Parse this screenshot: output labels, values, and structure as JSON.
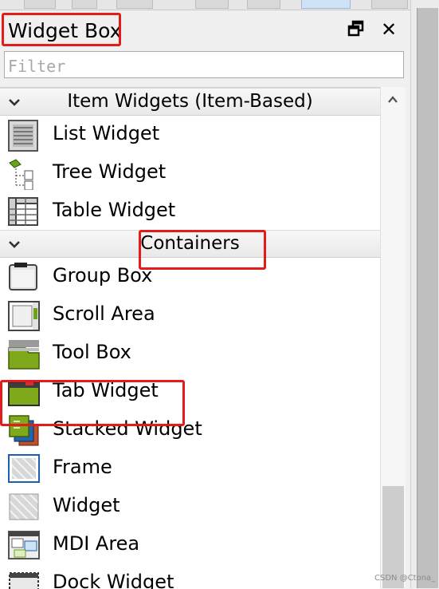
{
  "window": {
    "title": "Widget Box"
  },
  "filter": {
    "placeholder": "Filter"
  },
  "categories": [
    {
      "label": "Item Widgets (Item-Based)",
      "items": [
        {
          "label": "List Widget",
          "icon": "list-widget-icon"
        },
        {
          "label": "Tree Widget",
          "icon": "tree-widget-icon"
        },
        {
          "label": "Table Widget",
          "icon": "table-widget-icon"
        }
      ]
    },
    {
      "label": "Containers",
      "items": [
        {
          "label": "Group Box",
          "icon": "group-box-icon"
        },
        {
          "label": "Scroll Area",
          "icon": "scroll-area-icon"
        },
        {
          "label": "Tool Box",
          "icon": "tool-box-icon"
        },
        {
          "label": "Tab Widget",
          "icon": "tab-widget-icon"
        },
        {
          "label": "Stacked Widget",
          "icon": "stacked-widget-icon"
        },
        {
          "label": "Frame",
          "icon": "frame-icon"
        },
        {
          "label": "Widget",
          "icon": "widget-icon"
        },
        {
          "label": "MDI Area",
          "icon": "mdi-area-icon"
        },
        {
          "label": "Dock Widget",
          "icon": "dock-widget-icon"
        }
      ]
    }
  ],
  "watermark": "CSDN @Ctona_",
  "colors": {
    "highlight": "#e31b1b",
    "container_green": "#6a9a0a"
  }
}
